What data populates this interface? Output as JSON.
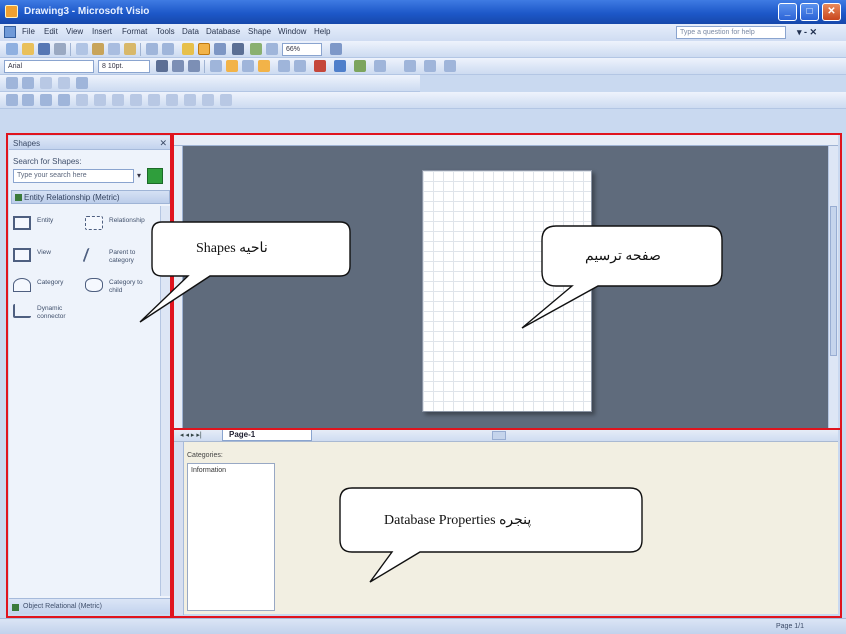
{
  "window": {
    "title": "Drawing3 - Microsoft Visio",
    "buttons": [
      "_",
      "□",
      "✕"
    ]
  },
  "menubar": {
    "items": [
      "File",
      "Edit",
      "View",
      "Insert",
      "Format",
      "Tools",
      "Data",
      "Database",
      "Shape",
      "Window",
      "Help"
    ],
    "help_placeholder": "Type a question for help",
    "mdi_controls": "▾ - ✕"
  },
  "formatting": {
    "font": "Arial",
    "size": "8 10pt.",
    "zoom": "66%"
  },
  "shapes_pane": {
    "title": "Shapes",
    "close": "✕",
    "search_label": "Search for Shapes:",
    "search_placeholder": "Type your search here",
    "stencil": "Entity Relationship (Metric)",
    "items": [
      {
        "label": "Entity"
      },
      {
        "label": "Relationship"
      },
      {
        "label": "View"
      },
      {
        "label": "Parent to category"
      },
      {
        "label": "Category"
      },
      {
        "label": "Category to child"
      },
      {
        "label": "Dynamic connector"
      }
    ],
    "footer_stencil": "Object Relational (Metric)"
  },
  "page_tabs": {
    "nav": "◂ ◂ ▸ ▸|",
    "active": "Page-1"
  },
  "db_properties": {
    "categories_label": "Categories:",
    "categories": [
      "Information"
    ]
  },
  "statusbar": {
    "page": "Page 1/1"
  },
  "callouts": {
    "shapes": "ناحیه Shapes",
    "drawing_page": "صفحه ترسیم",
    "db_properties": "پنجره Database Properties"
  },
  "colors": {
    "annotation_frame": "#e0141e",
    "title_bar": "#1d58c9",
    "canvas": "#5f6b7c"
  }
}
